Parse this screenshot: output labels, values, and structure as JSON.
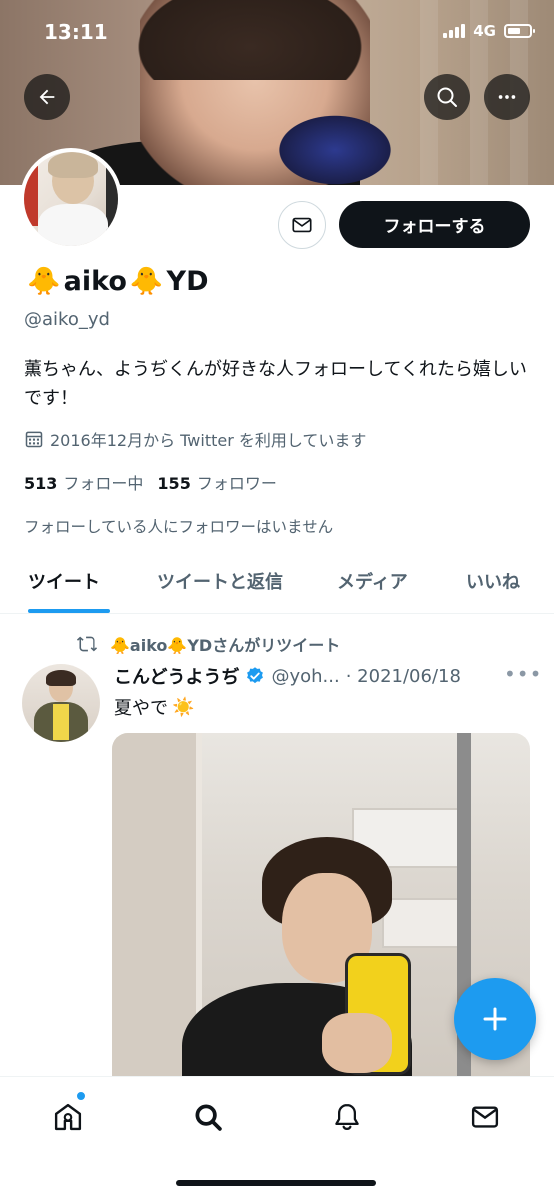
{
  "status_bar": {
    "time": "13:11",
    "network": "4G"
  },
  "header": {
    "back_icon": "arrow-left-icon",
    "search_icon": "search-icon",
    "more_icon": "more-horizontal-icon"
  },
  "profile": {
    "name_prefix_emoji": "🐥",
    "name_part1": "aiko",
    "name_mid_emoji": "🐥",
    "name_part2": "YD",
    "handle": "@aiko_yd",
    "bio": "薫ちゃん、ようぢくんが好きな人フォローしてくれたら嬉しいです！",
    "joined": "2016年12月から Twitter を利用しています",
    "following_count": "513",
    "following_label": "フォロー中",
    "followers_count": "155",
    "followers_label": "フォロワー",
    "mutual_note": "フォローしている人にフォロワーはいません",
    "follow_button": "フォローする"
  },
  "tabs": [
    {
      "label": "ツイート",
      "active": true
    },
    {
      "label": "ツイートと返信",
      "active": false
    },
    {
      "label": "メディア",
      "active": false
    },
    {
      "label": "いいね",
      "active": false
    }
  ],
  "tweet": {
    "retweet_by": "🐥aiko🐥YDさんがリツイート",
    "author_name": "こんどうようぢ",
    "author_handle": "@yoh...",
    "date": "· 2021/06/18",
    "text": "夏やで",
    "text_emoji": "☀️"
  },
  "colors": {
    "accent": "#1d9bf0",
    "text": "#0f1419",
    "secondary": "#536471",
    "follow_button_bg": "#0f1419"
  }
}
